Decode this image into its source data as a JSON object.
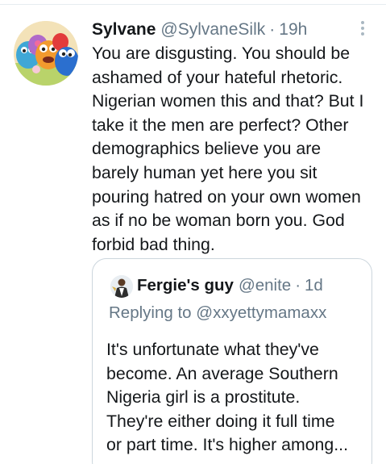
{
  "tweet": {
    "display_name": "Sylvane",
    "handle": "@SylvaneSilk",
    "separator": "·",
    "time": "19h",
    "text": "You are disgusting. You should be\nashamed of your hateful rhetoric.\nNigerian women this and that? But I\ntake it the men are perfect? Other\ndemographics believe you are\nbarely human yet here you sit\npouring hatred on your own women\nas if no be woman born you. God\nforbid bad thing.",
    "avatar_icon": "muppet-characters-avatar",
    "more_icon": "vertical-dots-icon"
  },
  "quoted_tweet": {
    "display_name": "Fergie's guy",
    "handle": "@enite",
    "separator": "·",
    "time": "1d",
    "replying_prefix": "Replying to",
    "replying_to": "@xxyettymamaxx",
    "text": "It's unfortunate what they've\nbecome. An average Southern\nNigeria girl is a prostitute.\nThey're either doing it full time\nor part time. It's higher among...",
    "avatar_icon": "person-photo-avatar"
  },
  "colors": {
    "text_primary": "#14171a",
    "text_secondary": "#657786",
    "border": "#ccd6dd",
    "background": "#ffffff"
  }
}
